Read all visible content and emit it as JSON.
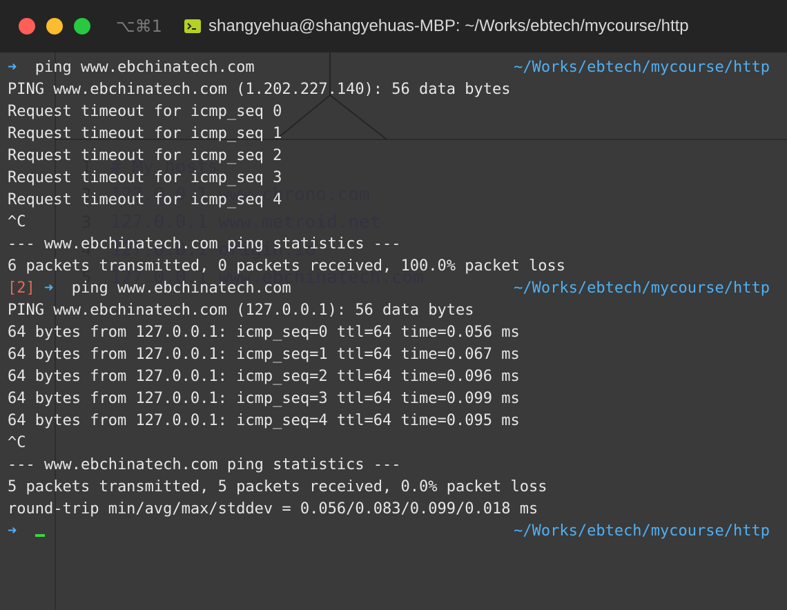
{
  "window": {
    "shortcut": "⌥⌘1",
    "title": "shangyehua@shangyehuas-MBP: ~/Works/ebtech/mycourse/http"
  },
  "background_editor": {
    "lines": [
      {
        "num": "1",
        "text": "# My hosts"
      },
      {
        "num": "2",
        "text": "127.0.0.1 www.chrono.com"
      },
      {
        "num": "3",
        "text": "127.0.0.1 www.metroid.net"
      },
      {
        "num": "4",
        "text": "127.0.0.1 origin.io"
      },
      {
        "num": "5",
        "text": "127.0.0.1 www.ebchinatech.com"
      }
    ]
  },
  "colors": {
    "arrow": "#4fb0f3",
    "path": "#4fb0f3",
    "error_code": "#e06a5a",
    "cursor": "#3ed43e",
    "text": "#e6e6e6"
  },
  "terminal": {
    "prompt_arrow": "➜",
    "cwd": "~/Works/ebtech/mycourse/http",
    "cmd1": "ping www.ebchinatech.com",
    "out1": [
      "PING www.ebchinatech.com (1.202.227.140): 56 data bytes",
      "Request timeout for icmp_seq 0",
      "Request timeout for icmp_seq 1",
      "Request timeout for icmp_seq 2",
      "Request timeout for icmp_seq 3",
      "Request timeout for icmp_seq 4",
      "^C",
      "--- www.ebchinatech.com ping statistics ---",
      "6 packets transmitted, 0 packets received, 100.0% packet loss"
    ],
    "exit_code": "[2]",
    "cmd2": "ping www.ebchinatech.com",
    "out2": [
      "PING www.ebchinatech.com (127.0.0.1): 56 data bytes",
      "64 bytes from 127.0.0.1: icmp_seq=0 ttl=64 time=0.056 ms",
      "64 bytes from 127.0.0.1: icmp_seq=1 ttl=64 time=0.067 ms",
      "64 bytes from 127.0.0.1: icmp_seq=2 ttl=64 time=0.096 ms",
      "64 bytes from 127.0.0.1: icmp_seq=3 ttl=64 time=0.099 ms",
      "64 bytes from 127.0.0.1: icmp_seq=4 ttl=64 time=0.095 ms",
      "^C",
      "--- www.ebchinatech.com ping statistics ---",
      "5 packets transmitted, 5 packets received, 0.0% packet loss",
      "round-trip min/avg/max/stddev = 0.056/0.083/0.099/0.018 ms"
    ]
  }
}
